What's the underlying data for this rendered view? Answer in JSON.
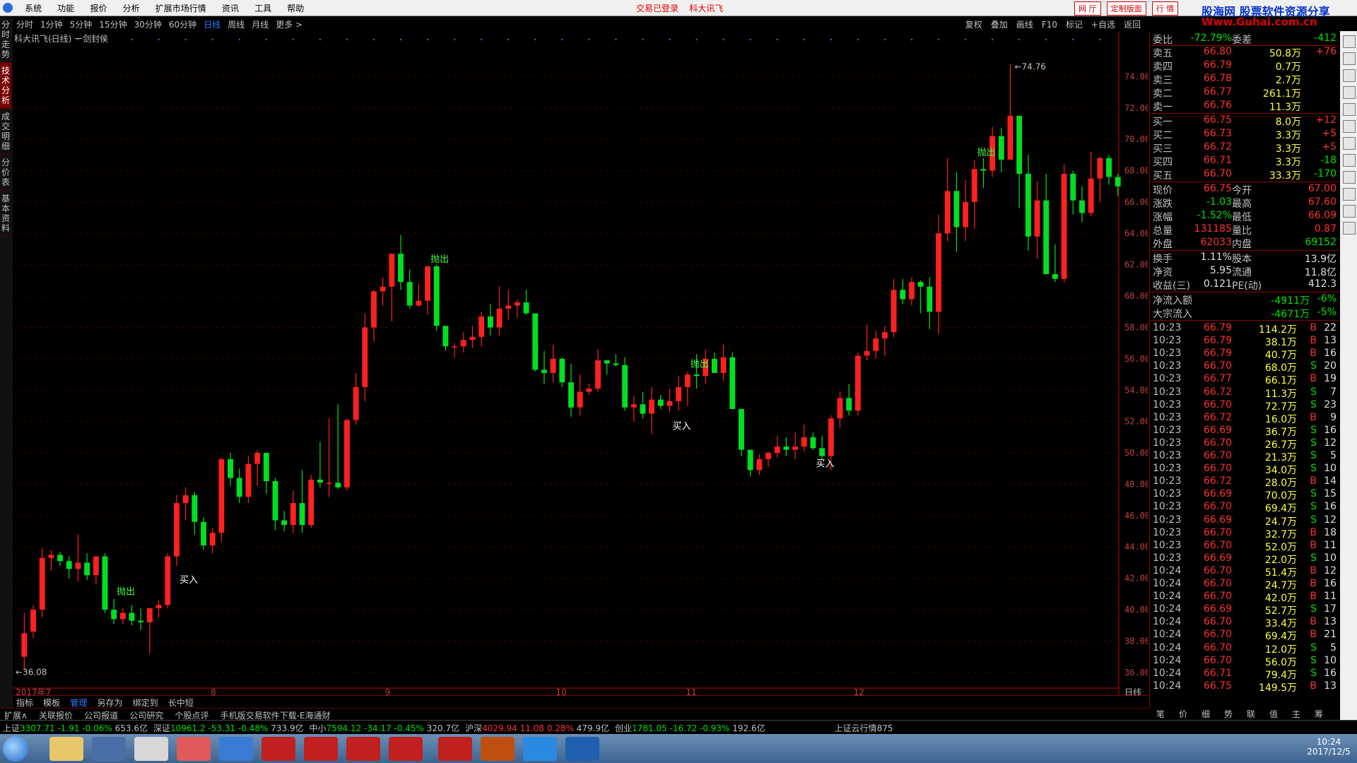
{
  "menu": {
    "items": [
      "系统",
      "功能",
      "报价",
      "分析",
      "扩展市场行情",
      "资讯",
      "工具",
      "帮助"
    ],
    "status": "交易已登录",
    "stock": "科大讯飞"
  },
  "topright": {
    "buttons": [
      "网 厅",
      "定制版面",
      "行 情"
    ]
  },
  "ad": {
    "line1": "股海网 股票软件资源分享",
    "line2": "Www.Guhai.com.cn"
  },
  "periods": [
    "分时",
    "1分钟",
    "5分钟",
    "15分钟",
    "30分钟",
    "60分钟",
    "日线",
    "周线",
    "月线",
    "更多 >"
  ],
  "active_period": "日线",
  "tools": [
    "复权",
    "叠加",
    "画线",
    "F10",
    "标记",
    "+自选",
    "返回"
  ],
  "left_tabs": [
    "分时走势",
    "技术分析",
    "成交明细",
    "分价表",
    "基本资料"
  ],
  "chart_title": "科大讯飞(日线) 一剑封侯",
  "chart_data": {
    "type": "candlestick",
    "ylim": [
      35,
      76
    ],
    "yticks": [
      "74.00",
      "72.00",
      "70.00",
      "68.00",
      "66.00",
      "64.00",
      "62.00",
      "60.00",
      "58.00",
      "56.00",
      "54.00",
      "52.00",
      "50.00",
      "48.00",
      "46.00",
      "44.00",
      "42.00",
      "40.00",
      "38.00",
      "36.00"
    ],
    "xlabels": [
      "2017年7",
      "8",
      "9",
      "10",
      "11",
      "12"
    ],
    "period_label": "日线",
    "high_note": "74.76",
    "low_note": "36.08",
    "signals": [
      {
        "label": "抛出",
        "idx": 10
      },
      {
        "label": "买入",
        "idx": 17
      },
      {
        "label": "抛出",
        "idx": 45
      },
      {
        "label": "买入",
        "idx": 72
      },
      {
        "label": "抛出",
        "idx": 74
      },
      {
        "label": "买入",
        "idx": 88
      },
      {
        "label": "抛出",
        "idx": 106
      }
    ],
    "candles": [
      [
        37.0,
        39.8,
        36.1,
        38.5
      ],
      [
        38.6,
        40.3,
        38.2,
        40.0
      ],
      [
        40.0,
        43.9,
        39.5,
        43.3
      ],
      [
        43.3,
        43.8,
        42.5,
        43.5
      ],
      [
        43.5,
        43.7,
        42.8,
        43.1
      ],
      [
        43.1,
        43.4,
        42.0,
        42.6
      ],
      [
        42.6,
        44.8,
        41.8,
        43.0
      ],
      [
        43.0,
        43.6,
        41.9,
        42.2
      ],
      [
        42.2,
        43.4,
        41.6,
        43.4
      ],
      [
        43.4,
        43.6,
        39.8,
        40.0
      ],
      [
        40.0,
        40.7,
        39.1,
        39.4
      ],
      [
        39.4,
        40.1,
        39.1,
        39.8
      ],
      [
        39.8,
        40.3,
        39.0,
        39.3
      ],
      [
        39.3,
        40.1,
        38.7,
        39.2
      ],
      [
        39.2,
        40.0,
        37.2,
        40.1
      ],
      [
        40.1,
        40.6,
        39.5,
        40.3
      ],
      [
        40.3,
        43.6,
        40.1,
        43.4
      ],
      [
        43.4,
        47.3,
        42.8,
        46.8
      ],
      [
        46.8,
        47.8,
        45.7,
        47.3
      ],
      [
        47.3,
        47.5,
        44.8,
        45.6
      ],
      [
        45.6,
        45.9,
        43.8,
        44.1
      ],
      [
        44.1,
        45.2,
        43.6,
        44.9
      ],
      [
        44.9,
        49.7,
        44.3,
        49.6
      ],
      [
        49.6,
        50.0,
        47.9,
        48.4
      ],
      [
        48.4,
        49.0,
        46.8,
        47.2
      ],
      [
        47.2,
        49.8,
        46.8,
        49.3
      ],
      [
        49.3,
        50.2,
        47.9,
        50.0
      ],
      [
        50.0,
        48.9,
        47.4,
        48.2
      ],
      [
        48.2,
        48.4,
        45.1,
        45.7
      ],
      [
        45.7,
        46.3,
        45.0,
        45.4
      ],
      [
        45.4,
        47.6,
        44.9,
        46.8
      ],
      [
        46.8,
        48.9,
        44.9,
        45.4
      ],
      [
        45.4,
        48.6,
        45.2,
        48.3
      ],
      [
        48.3,
        50.7,
        47.8,
        48.1
      ],
      [
        48.1,
        52.2,
        47.2,
        48.1
      ],
      [
        48.1,
        53.1,
        47.7,
        47.8
      ],
      [
        47.8,
        52.2,
        47.6,
        52.1
      ],
      [
        52.1,
        55.1,
        51.8,
        54.2
      ],
      [
        54.2,
        58.9,
        53.3,
        58.0
      ],
      [
        58.0,
        60.4,
        57.1,
        60.3
      ],
      [
        60.3,
        61.2,
        59.4,
        60.6
      ],
      [
        60.6,
        61.1,
        58.4,
        62.7
      ],
      [
        62.7,
        63.9,
        60.4,
        60.9
      ],
      [
        60.9,
        61.7,
        59.2,
        59.4
      ],
      [
        59.4,
        60.8,
        59.3,
        59.7
      ],
      [
        59.7,
        61.7,
        58.8,
        61.9
      ],
      [
        61.9,
        62.0,
        57.8,
        58.1
      ],
      [
        58.1,
        58.1,
        56.5,
        56.8
      ],
      [
        56.8,
        57.0,
        56.1,
        56.8
      ],
      [
        56.8,
        57.7,
        56.4,
        57.2
      ],
      [
        57.2,
        58.1,
        56.7,
        57.4
      ],
      [
        57.4,
        59.0,
        56.8,
        58.7
      ],
      [
        58.7,
        59.5,
        57.5,
        58.0
      ],
      [
        58.0,
        60.6,
        57.5,
        59.2
      ],
      [
        59.2,
        60.4,
        58.5,
        59.4
      ],
      [
        59.4,
        59.8,
        58.6,
        59.6
      ],
      [
        59.6,
        60.4,
        58.8,
        58.9
      ],
      [
        58.9,
        58.9,
        55.2,
        55.3
      ],
      [
        55.3,
        56.5,
        54.4,
        55.1
      ],
      [
        55.1,
        56.9,
        54.5,
        56.0
      ],
      [
        56.0,
        56.1,
        54.2,
        54.5
      ],
      [
        54.5,
        55.7,
        52.3,
        52.9
      ],
      [
        52.9,
        55.0,
        52.4,
        53.9
      ],
      [
        53.9,
        54.4,
        53.7,
        54.1
      ],
      [
        54.1,
        56.6,
        53.9,
        55.9
      ],
      [
        55.9,
        55.6,
        55.0,
        55.7
      ],
      [
        55.7,
        56.3,
        55.5,
        55.6
      ],
      [
        55.6,
        56.1,
        52.7,
        52.9
      ],
      [
        52.9,
        53.6,
        52.0,
        53.1
      ],
      [
        53.1,
        53.9,
        52.2,
        52.5
      ],
      [
        52.5,
        54.2,
        51.2,
        53.4
      ],
      [
        53.4,
        53.7,
        52.8,
        53.0
      ],
      [
        53.0,
        54.1,
        52.6,
        53.3
      ],
      [
        53.3,
        54.9,
        52.7,
        54.2
      ],
      [
        54.2,
        55.2,
        53.0,
        55.0
      ],
      [
        55.0,
        56.3,
        54.1,
        54.9
      ],
      [
        54.9,
        56.6,
        54.4,
        56.0
      ],
      [
        56.0,
        56.4,
        55.1,
        55.1
      ],
      [
        55.1,
        56.9,
        54.6,
        56.1
      ],
      [
        56.1,
        56.4,
        52.9,
        52.8
      ],
      [
        52.8,
        52.4,
        49.8,
        50.2
      ],
      [
        50.2,
        49.5,
        48.5,
        48.9
      ],
      [
        48.9,
        49.9,
        48.6,
        49.6
      ],
      [
        49.6,
        50.1,
        49.1,
        50.0
      ],
      [
        50.0,
        51.1,
        49.7,
        50.4
      ],
      [
        50.4,
        51.0,
        49.8,
        50.2
      ],
      [
        50.2,
        51.3,
        49.6,
        50.4
      ],
      [
        50.4,
        51.8,
        50.1,
        51.0
      ],
      [
        51.0,
        51.3,
        50.2,
        50.3
      ],
      [
        50.3,
        51.1,
        49.6,
        49.8
      ],
      [
        49.8,
        52.4,
        48.9,
        52.2
      ],
      [
        52.2,
        53.9,
        51.6,
        53.5
      ],
      [
        53.5,
        54.4,
        52.4,
        52.7
      ],
      [
        52.7,
        56.4,
        52.4,
        56.2
      ],
      [
        56.2,
        58.2,
        55.9,
        56.5
      ],
      [
        56.5,
        57.8,
        56.0,
        57.3
      ],
      [
        57.3,
        58.1,
        56.2,
        57.7
      ],
      [
        57.7,
        61.1,
        57.4,
        60.4
      ],
      [
        60.4,
        61.1,
        59.5,
        59.8
      ],
      [
        59.8,
        61.2,
        59.4,
        60.9
      ],
      [
        60.9,
        61.0,
        58.9,
        60.6
      ],
      [
        60.6,
        61.2,
        57.9,
        59.0
      ],
      [
        59.0,
        65.2,
        57.6,
        64.0
      ],
      [
        64.0,
        68.8,
        63.5,
        66.7
      ],
      [
        66.7,
        67.9,
        62.8,
        64.4
      ],
      [
        64.4,
        67.4,
        63.5,
        66.0
      ],
      [
        66.0,
        68.7,
        64.3,
        68.1
      ],
      [
        68.1,
        68.8,
        66.9,
        68.0
      ],
      [
        68.0,
        70.8,
        67.6,
        70.2
      ],
      [
        70.2,
        70.7,
        67.9,
        68.7
      ],
      [
        68.7,
        74.8,
        69.8,
        71.5
      ],
      [
        71.5,
        70.3,
        65.6,
        67.8
      ],
      [
        67.8,
        69.0,
        62.9,
        63.8
      ],
      [
        63.8,
        67.3,
        62.4,
        66.1
      ],
      [
        66.1,
        67.8,
        61.9,
        61.4
      ],
      [
        61.4,
        63.3,
        60.9,
        61.1
      ],
      [
        61.1,
        68.4,
        60.9,
        67.8
      ],
      [
        67.8,
        68.0,
        65.2,
        66.1
      ],
      [
        66.1,
        67.0,
        64.7,
        65.3
      ],
      [
        65.3,
        69.2,
        65.1,
        67.5
      ],
      [
        67.5,
        68.9,
        66.0,
        68.8
      ],
      [
        68.8,
        69.0,
        67.1,
        67.6
      ],
      [
        67.6,
        67.8,
        66.4,
        67.0
      ]
    ]
  },
  "quote": {
    "weibi": {
      "label": "委比",
      "value": "-72.79%",
      "label2": "委差",
      "value2": "-412"
    },
    "sell": [
      {
        "label": "卖五",
        "price": "66.80",
        "vol": "50.8万",
        "chg": "+76"
      },
      {
        "label": "卖四",
        "price": "66.79",
        "vol": "0.7万",
        "chg": ""
      },
      {
        "label": "卖三",
        "price": "66.78",
        "vol": "2.7万",
        "chg": ""
      },
      {
        "label": "卖二",
        "price": "66.77",
        "vol": "261.1万",
        "chg": ""
      },
      {
        "label": "卖一",
        "price": "66.76",
        "vol": "11.3万",
        "chg": ""
      }
    ],
    "buy": [
      {
        "label": "买一",
        "price": "66.75",
        "vol": "8.0万",
        "chg": "+12"
      },
      {
        "label": "买二",
        "price": "66.73",
        "vol": "3.3万",
        "chg": "+5"
      },
      {
        "label": "买三",
        "price": "66.72",
        "vol": "3.3万",
        "chg": "+5"
      },
      {
        "label": "买四",
        "price": "66.71",
        "vol": "3.3万",
        "chg": "-18"
      },
      {
        "label": "买五",
        "price": "66.70",
        "vol": "33.3万",
        "chg": "-170"
      }
    ],
    "stats": [
      {
        "l1": "现价",
        "v1": "66.75",
        "l2": "今开",
        "v2": "67.00"
      },
      {
        "l1": "涨跌",
        "v1": "-1.03",
        "l2": "最高",
        "v2": "67.60"
      },
      {
        "l1": "涨幅",
        "v1": "-1.52%",
        "l2": "最低",
        "v2": "66.09"
      },
      {
        "l1": "总量",
        "v1": "131185",
        "l2": "量比",
        "v2": "0.87"
      },
      {
        "l1": "外盘",
        "v1": "62033",
        "l2": "内盘",
        "v2": "69152"
      }
    ],
    "fund": [
      {
        "l1": "换手",
        "v1": "1.11%",
        "l2": "股本",
        "v2": "13.9亿"
      },
      {
        "l1": "净资",
        "v1": "5.95",
        "l2": "流通",
        "v2": "11.8亿"
      },
      {
        "l1": "收益(三)",
        "v1": "0.121",
        "l2": "PE(动)",
        "v2": "412.3"
      }
    ],
    "flow": [
      {
        "label": "净流入额",
        "value": "-4911万",
        "pct": "-6%"
      },
      {
        "label": "大宗流入",
        "value": "-4671万",
        "pct": "-5%"
      }
    ]
  },
  "ticks": [
    [
      "10:23",
      "66.79",
      "114.2万",
      "B",
      "22"
    ],
    [
      "10:23",
      "66.79",
      "38.1万",
      "B",
      "13"
    ],
    [
      "10:23",
      "66.79",
      "40.7万",
      "B",
      "16"
    ],
    [
      "10:23",
      "66.70",
      "68.0万",
      "S",
      "20"
    ],
    [
      "10:23",
      "66.77",
      "66.1万",
      "B",
      "19"
    ],
    [
      "10:23",
      "66.72",
      "11.3万",
      "S",
      "7"
    ],
    [
      "10:23",
      "66.70",
      "72.7万",
      "S",
      "23"
    ],
    [
      "10:23",
      "66.72",
      "16.0万",
      "B",
      "9"
    ],
    [
      "10:23",
      "66.69",
      "36.7万",
      "S",
      "16"
    ],
    [
      "10:23",
      "66.70",
      "26.7万",
      "S",
      "12"
    ],
    [
      "10:23",
      "66.70",
      "21.3万",
      "S",
      "5"
    ],
    [
      "10:23",
      "66.70",
      "34.0万",
      "S",
      "10"
    ],
    [
      "10:23",
      "66.72",
      "28.0万",
      "B",
      "14"
    ],
    [
      "10:23",
      "66.69",
      "70.0万",
      "S",
      "15"
    ],
    [
      "10:23",
      "66.70",
      "69.4万",
      "S",
      "16"
    ],
    [
      "10:23",
      "66.69",
      "24.7万",
      "S",
      "12"
    ],
    [
      "10:23",
      "66.70",
      "32.7万",
      "B",
      "18"
    ],
    [
      "10:23",
      "66.70",
      "52.0万",
      "B",
      "11"
    ],
    [
      "10:23",
      "66.69",
      "22.0万",
      "S",
      "10"
    ],
    [
      "10:24",
      "66.70",
      "51.4万",
      "B",
      "12"
    ],
    [
      "10:24",
      "66.70",
      "24.7万",
      "B",
      "16"
    ],
    [
      "10:24",
      "66.70",
      "42.0万",
      "B",
      "11"
    ],
    [
      "10:24",
      "66.69",
      "52.7万",
      "S",
      "17"
    ],
    [
      "10:24",
      "66.70",
      "33.4万",
      "B",
      "13"
    ],
    [
      "10:24",
      "66.70",
      "69.4万",
      "B",
      "21"
    ],
    [
      "10:24",
      "66.70",
      "12.0万",
      "S",
      "5"
    ],
    [
      "10:24",
      "66.70",
      "56.0万",
      "S",
      "10"
    ],
    [
      "10:24",
      "66.71",
      "79.4万",
      "S",
      "16"
    ],
    [
      "10:24",
      "66.75",
      "149.5万",
      "B",
      "13"
    ]
  ],
  "bottom_tabs": [
    "指标",
    "模板",
    "管理",
    "另存为",
    "绑定到",
    "长中短"
  ],
  "active_bottom_tab": "管理",
  "info_tabs": [
    "扩展∧",
    "关联报价",
    "公司报道",
    "公司研究",
    "个股点评",
    "手机版交易软件下载-E海通财"
  ],
  "right_bottom_tabs": [
    "笔",
    "价",
    "细",
    "势",
    "联",
    "值",
    "主",
    "筹"
  ],
  "indices": [
    {
      "name": "上证",
      "v": "3307.71",
      "c": "-1.91",
      "p": "-0.06%",
      "a": "653.6亿",
      "dir": "down"
    },
    {
      "name": "深证",
      "v": "10961.2",
      "c": "-53.31",
      "p": "-0.48%",
      "a": "733.9亿",
      "dir": "down"
    },
    {
      "name": "中小",
      "v": "7594.12",
      "c": "-34.17",
      "p": "-0.45%",
      "a": "320.7亿",
      "dir": "down"
    },
    {
      "name": "沪深",
      "v": "4029.94",
      "c": "11.08",
      "p": "0.28%",
      "a": "479.9亿",
      "dir": "up"
    },
    {
      "name": "创业",
      "v": "1781.05",
      "c": "-16.72",
      "p": "-0.93%",
      "a": "192.6亿",
      "dir": "down"
    }
  ],
  "cloud_label": "上证云行情875",
  "clock": {
    "time": "10:24",
    "date": "2017/12/5"
  },
  "colors": {
    "up": "#ff2020",
    "down": "#00e020",
    "grid": "#600000",
    "axis": "#c00000",
    "accent": "#2c7cff"
  }
}
